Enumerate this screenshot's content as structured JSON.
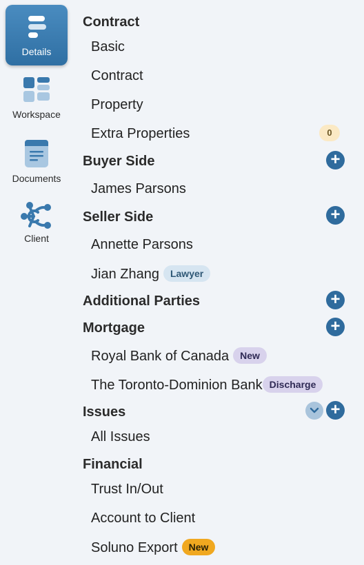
{
  "rail": {
    "details": "Details",
    "workspace": "Workspace",
    "documents": "Documents",
    "client": "Client"
  },
  "nav": {
    "contract": {
      "header": "Contract",
      "items": [
        "Basic",
        "Contract",
        "Property",
        "Extra Properties"
      ],
      "extra_properties_count": "0"
    },
    "buyer_side": {
      "header": "Buyer Side",
      "items": [
        "James Parsons"
      ],
      "add": "+"
    },
    "seller_side": {
      "header": "Seller Side",
      "items": [
        "Annette Parsons",
        "Jian Zhang"
      ],
      "jian_badge": "Lawyer",
      "add": "+"
    },
    "additional_parties": {
      "header": "Additional Parties",
      "add": "+"
    },
    "mortgage": {
      "header": "Mortgage",
      "items": [
        "Royal Bank of Canada",
        "The Toronto-Dominion Bank"
      ],
      "rbc_badge": "New",
      "td_badge": "Discharge",
      "add": "+"
    },
    "issues": {
      "header": "Issues",
      "items": [
        "All Issues"
      ],
      "add": "+"
    },
    "financial": {
      "header": "Financial",
      "items": [
        "Trust In/Out",
        "Account to Client",
        "Soluno Export"
      ],
      "soluno_badge": "New"
    }
  }
}
